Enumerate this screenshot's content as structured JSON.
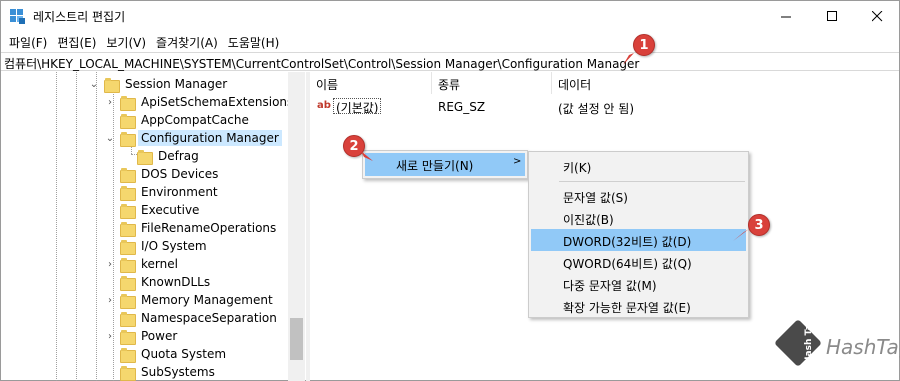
{
  "window": {
    "title": "레지스트리 편집기",
    "controls": {
      "minimize": "minimize-icon",
      "maximize": "maximize-icon",
      "close": "close-icon"
    }
  },
  "menu": [
    "파일(F)",
    "편집(E)",
    "보기(V)",
    "즐겨찾기(A)",
    "도움말(H)"
  ],
  "address": "컴퓨터\\HKEY_LOCAL_MACHINE\\SYSTEM\\CurrentControlSet\\Control\\Session Manager\\Configuration Manager",
  "tree": {
    "items": [
      {
        "label": "Session Manager",
        "expanded": true
      },
      {
        "label": "ApiSetSchemaExtensions",
        "expandable": true
      },
      {
        "label": "AppCompatCache",
        "expandable": false
      },
      {
        "label": "Configuration Manager",
        "expanded": true,
        "selected": true
      },
      {
        "label": "Defrag",
        "expandable": false
      },
      {
        "label": "DOS Devices",
        "expandable": false
      },
      {
        "label": "Environment",
        "expandable": false
      },
      {
        "label": "Executive",
        "expandable": false
      },
      {
        "label": "FileRenameOperations",
        "expandable": false
      },
      {
        "label": "I/O System",
        "expandable": false
      },
      {
        "label": "kernel",
        "expandable": true
      },
      {
        "label": "KnownDLLs",
        "expandable": false
      },
      {
        "label": "Memory Management",
        "expandable": true
      },
      {
        "label": "NamespaceSeparation",
        "expandable": false
      },
      {
        "label": "Power",
        "expandable": true
      },
      {
        "label": "Quota System",
        "expandable": false
      },
      {
        "label": "SubSystems",
        "expandable": false
      }
    ]
  },
  "values": {
    "columns": [
      "이름",
      "종류",
      "데이터"
    ],
    "rows": [
      {
        "name": "(기본값)",
        "type": "REG_SZ",
        "data": "(값 설정 안 됨)",
        "icon": "ab"
      }
    ]
  },
  "context_menu": {
    "parent_label": "새로 만들기(N)",
    "items": [
      {
        "label": "키(K)"
      },
      {
        "label": "문자열 값(S)"
      },
      {
        "label": "이진값(B)"
      },
      {
        "label": "DWORD(32비트) 값(D)",
        "highlighted": true
      },
      {
        "label": "QWORD(64비트) 값(Q)"
      },
      {
        "label": "다중 문자열 값(M)"
      },
      {
        "label": "확장 가능한 문자열 값(E)"
      }
    ]
  },
  "badges": [
    "1",
    "2",
    "3"
  ],
  "watermark": {
    "text": "HashTag",
    "logo_text": "Hash Tag"
  },
  "colors": {
    "selection": "#cce8ff",
    "menu_highlight": "#91c9f7",
    "badge": "#d9413b",
    "folder": "#f5d76e"
  }
}
